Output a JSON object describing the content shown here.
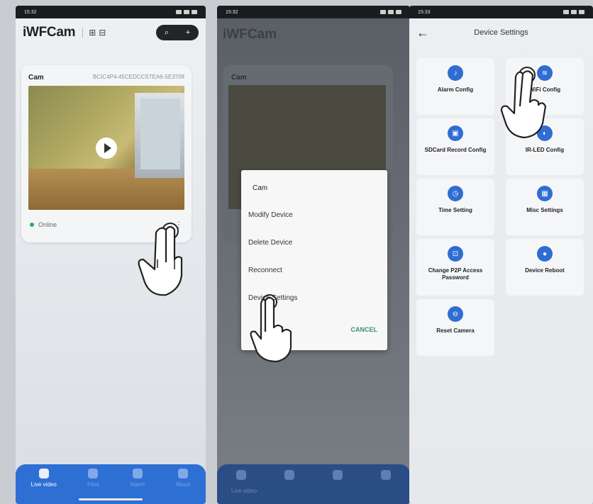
{
  "status_time": [
    "15:32",
    "15:32",
    "15:33"
  ],
  "phone1": {
    "brand": "iWFCam",
    "card": {
      "name": "Cam",
      "id": "BCIC4P4-45CEDCCSTEA6-5E3708",
      "status": "Online"
    },
    "nav": [
      "Live video",
      "Files",
      "Alarm",
      "About"
    ]
  },
  "phone2": {
    "brand": "iWFCam",
    "card_name": "Cam",
    "dialog": {
      "title": "Cam",
      "items": [
        "Modify Device",
        "Delete Device",
        "Reconnect",
        "Device Settings"
      ],
      "cancel": "CANCEL"
    },
    "nav_label": "Live video"
  },
  "phone3": {
    "title": "Device Settings",
    "settings": [
      "Alarm Config",
      "WiFi Config",
      "SDCard Record Config",
      "IR-LED Config",
      "Time Setting",
      "Misc Settings",
      "Change P2P Access Password",
      "Device Reboot",
      "Reset Camera"
    ]
  },
  "colors": {
    "accent": "#2e6fd4",
    "online": "#39a85a",
    "cancel": "#3a8f7a"
  },
  "icons": [
    "plus-icon",
    "search-icon",
    "play-icon",
    "bell-icon",
    "wifi-icon",
    "sd-card-icon",
    "led-icon",
    "clock-icon",
    "grid-icon",
    "lock-icon",
    "reboot-icon",
    "reset-icon",
    "hand-pointer-icon"
  ]
}
